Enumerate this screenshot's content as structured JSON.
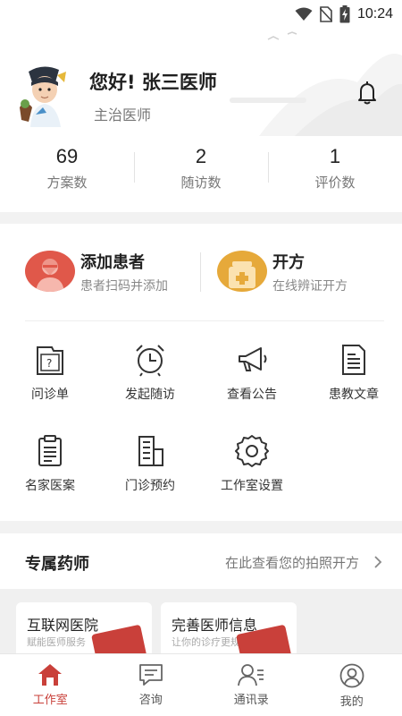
{
  "status_bar": {
    "time": "10:24"
  },
  "profile": {
    "greeting": "您好! 张三医师",
    "role": "主治医师"
  },
  "stats": [
    {
      "value": "69",
      "label": "方案数"
    },
    {
      "value": "2",
      "label": "随访数"
    },
    {
      "value": "1",
      "label": "评价数"
    }
  ],
  "primary_actions": [
    {
      "title": "添加患者",
      "subtitle": "患者扫码并添加",
      "icon": "add-patient-icon",
      "color": "#e0584a"
    },
    {
      "title": "开方",
      "subtitle": "在线辨证开方",
      "icon": "medicine-box-icon",
      "color": "#e6a93a"
    }
  ],
  "grid": [
    {
      "label": "问诊单",
      "icon": "inquiry-form-icon"
    },
    {
      "label": "发起随访",
      "icon": "alarm-clock-icon"
    },
    {
      "label": "查看公告",
      "icon": "megaphone-icon"
    },
    {
      "label": "患教文章",
      "icon": "article-icon"
    },
    {
      "label": "名家医案",
      "icon": "clipboard-icon"
    },
    {
      "label": "门诊预约",
      "icon": "building-icon"
    },
    {
      "label": "工作室设置",
      "icon": "gear-icon"
    }
  ],
  "pharmacist": {
    "title": "专属药师",
    "link": "在此查看您的拍照开方"
  },
  "cards": [
    {
      "title": "互联网医院",
      "subtitle": "赋能医师服务"
    },
    {
      "title": "完善医师信息",
      "subtitle": "让你的诊疗更规范"
    }
  ],
  "tabs": [
    {
      "label": "工作室",
      "icon": "home-icon",
      "active": true
    },
    {
      "label": "咨询",
      "icon": "chat-icon",
      "active": false
    },
    {
      "label": "通讯录",
      "icon": "contacts-icon",
      "active": false
    },
    {
      "label": "我的",
      "icon": "profile-icon",
      "active": false
    }
  ],
  "colors": {
    "accent": "#c9403a",
    "orange": "#e6a93a",
    "red": "#e0584a"
  }
}
